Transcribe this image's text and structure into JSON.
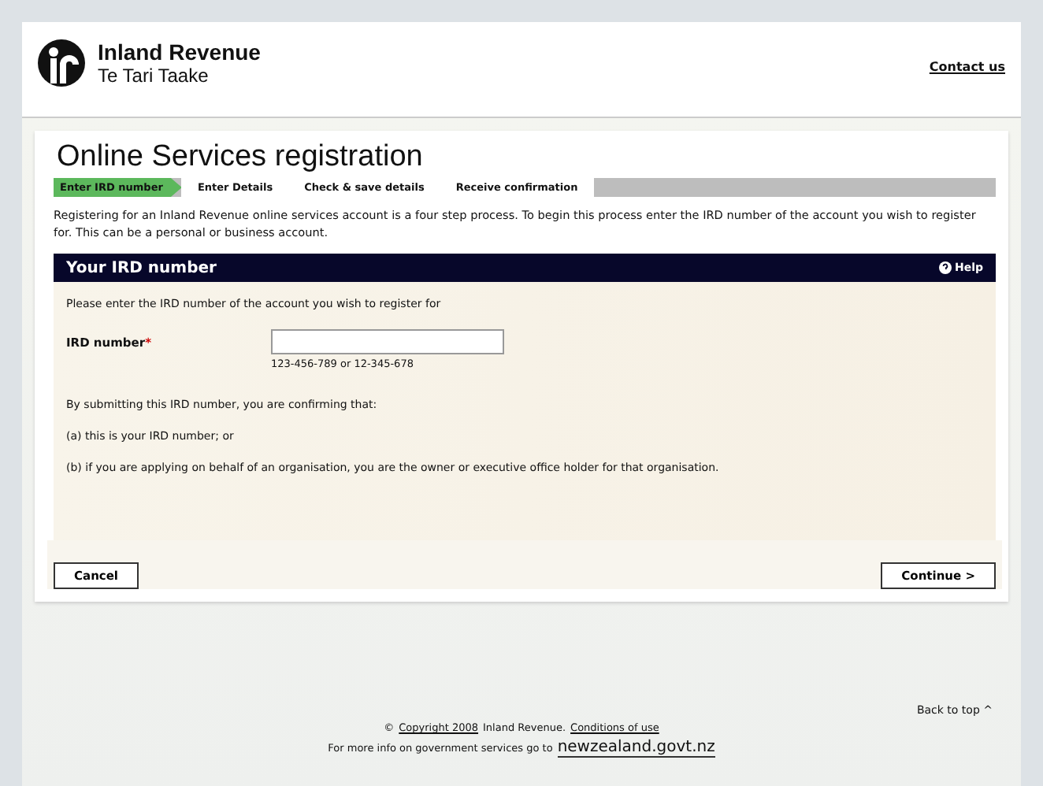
{
  "header": {
    "brand_name": "Inland Revenue",
    "brand_subtitle": "Te Tari Taake",
    "contact_link": "Contact us"
  },
  "page": {
    "title": "Online Services registration"
  },
  "steps": [
    {
      "label": "Enter IRD number",
      "selected": true
    },
    {
      "label": "Enter Details",
      "selected": false
    },
    {
      "label": "Check & save details",
      "selected": false
    },
    {
      "label": "Receive confirmation",
      "selected": false
    }
  ],
  "intro": "Registering for an Inland Revenue online services account is a four step process. To begin this process enter the IRD number of the account you wish to register for. This can be a personal or business account.",
  "section": {
    "title": "Your IRD number",
    "help": "Help",
    "prompt": "Please enter the IRD number of the account you wish to register for",
    "field": {
      "label": "IRD number",
      "required_mark": "*",
      "hint": "123-456-789 or 12-345-678"
    },
    "paragraphs": [
      "By submitting this IRD number, you are confirming that:",
      "(a) this is your IRD number; or",
      "(b) if you are applying on behalf of an organisation, you are the owner or executive office holder for that organisation."
    ]
  },
  "buttons": {
    "cancel": "Cancel",
    "continue": "Continue >"
  },
  "footer": {
    "back_to_top": "Back to top ^",
    "copyright_symbol": "©",
    "copyright_link": "Copyright 2008",
    "owner": "Inland Revenue.",
    "conditions_link": "Conditions of use",
    "more_info": "For more info on government services go to",
    "govt_link": "newzealand.govt.nz"
  }
}
